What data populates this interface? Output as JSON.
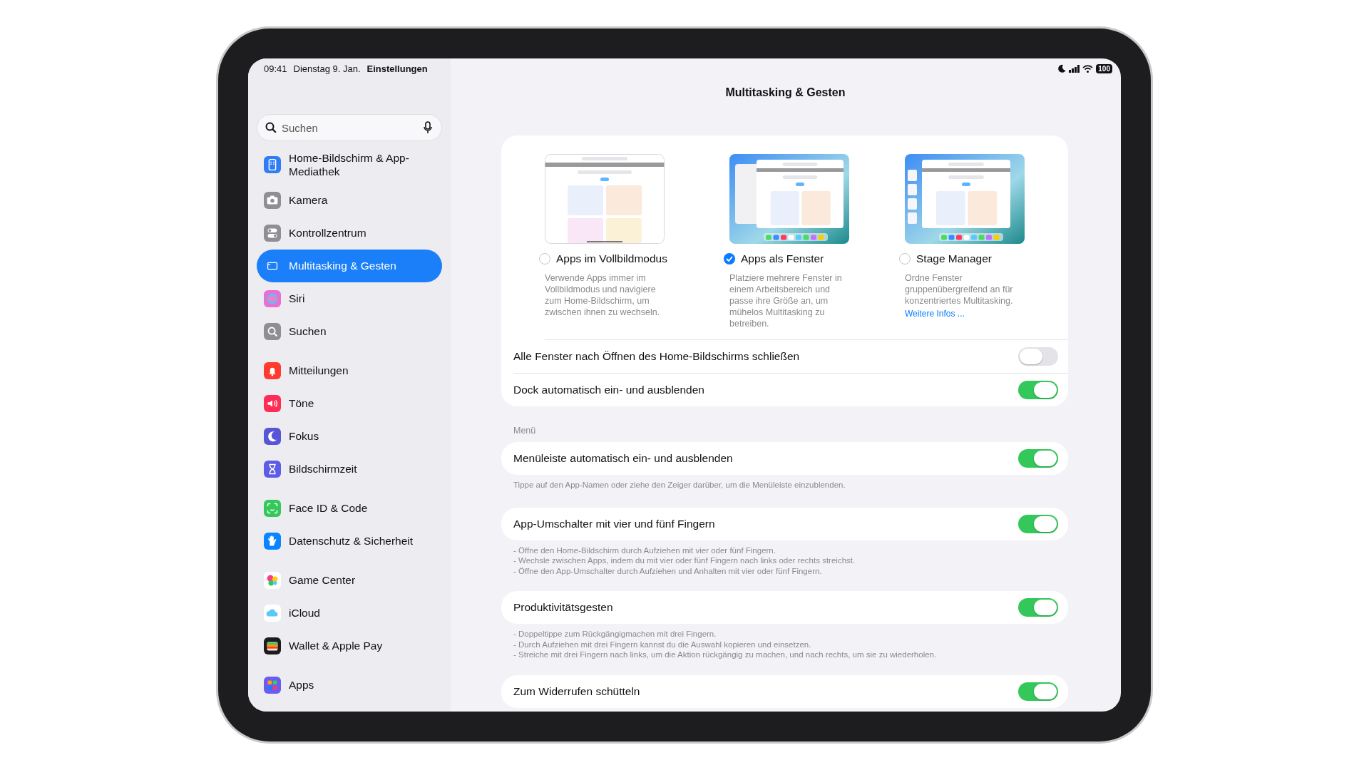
{
  "status_bar": {
    "time": "09:41",
    "date": "Dienstag 9. Jan.",
    "app": "Einstellungen",
    "battery": "100"
  },
  "sidebar": {
    "search": {
      "placeholder": "Suchen"
    },
    "groups": [
      [
        {
          "label": "Home-Bildschirm & App-Mediathek",
          "color": "#2f7cf6",
          "selected": false
        },
        {
          "label": "Kamera",
          "color": "#8e8e93",
          "selected": false
        },
        {
          "label": "Kontrollzentrum",
          "color": "#8e8e93",
          "selected": false
        },
        {
          "label": "Multitasking & Gesten",
          "color": "#1a7ff8",
          "selected": true
        },
        {
          "label": "Siri",
          "color": "#e96fd0",
          "selected": false
        },
        {
          "label": "Suchen",
          "color": "#8e8e93",
          "selected": false
        }
      ],
      [
        {
          "label": "Mitteilungen",
          "color": "#ff3b30",
          "selected": false
        },
        {
          "label": "Töne",
          "color": "#ff2d55",
          "selected": false
        },
        {
          "label": "Fokus",
          "color": "#5856d6",
          "selected": false
        },
        {
          "label": "Bildschirmzeit",
          "color": "#5e5ce6",
          "selected": false
        }
      ],
      [
        {
          "label": "Face ID & Code",
          "color": "#34c759",
          "selected": false
        },
        {
          "label": "Datenschutz & Sicherheit",
          "color": "#0a84ff",
          "selected": false
        }
      ],
      [
        {
          "label": "Game Center",
          "color": "#ffffff",
          "selected": false
        },
        {
          "label": "iCloud",
          "color": "#ffffff",
          "selected": false
        },
        {
          "label": "Wallet & Apple Pay",
          "color": "#1c1c1e",
          "selected": false
        }
      ],
      [
        {
          "label": "Apps",
          "color": "#6a5cf0",
          "selected": false
        }
      ]
    ]
  },
  "content": {
    "title": "Multitasking & Gesten",
    "modes": [
      {
        "kind": "fullscreen",
        "label": "Apps im Vollbildmodus",
        "selected": false,
        "description": "Verwende Apps immer im Vollbildmodus und navigiere zum Home-Bildschirm, um zwischen ihnen zu wechseln."
      },
      {
        "kind": "windows",
        "label": "Apps als Fenster",
        "selected": true,
        "description": "Platziere mehrere Fenster in einem Arbeitsbereich und passe ihre Größe an, um mühelos Multitasking zu betreiben."
      },
      {
        "kind": "stage",
        "label": "Stage Manager",
        "selected": false,
        "description": "Ordne Fenster gruppenübergreifend an für konzentriertes Multitasking.",
        "link": "Weitere Infos ..."
      }
    ],
    "mode_rows": [
      {
        "label": "Alle Fenster nach Öffnen des Home-Bildschirms schließen",
        "on": false
      },
      {
        "label": "Dock automatisch ein- und ausblenden",
        "on": true
      }
    ],
    "sections": [
      {
        "header": "Menü",
        "rows": [
          {
            "label": "Menüleiste automatisch ein- und ausblenden",
            "on": true
          }
        ],
        "footer": [
          "Tippe auf den App-Namen oder ziehe den Zeiger darüber, um die Menüleiste einzublenden."
        ]
      },
      {
        "rows": [
          {
            "label": "App-Umschalter mit vier und fünf Fingern",
            "on": true
          }
        ],
        "footer": [
          "- Öffne den Home-Bildschirm durch Aufziehen mit vier oder fünf Fingern.",
          "- Wechsle zwischen Apps, indem du mit vier oder fünf Fingern nach links oder rechts streichst.",
          "- Öffne den App-Umschalter durch Aufziehen und Anhalten mit vier oder fünf Fingern."
        ]
      },
      {
        "rows": [
          {
            "label": "Produktivitätsgesten",
            "on": true
          }
        ],
        "footer": [
          "- Doppeltippe zum Rückgängigmachen mit drei Fingern.",
          "- Durch Aufziehen mit drei Fingern kannst du die Auswahl kopieren und einsetzen.",
          "- Streiche mit drei Fingern nach links, um die Aktion rückgängig zu machen, und nach rechts, um sie zu wiederholen."
        ]
      },
      {
        "rows": [
          {
            "label": "Zum Widerrufen schütteln",
            "on": true
          }
        ]
      }
    ]
  }
}
